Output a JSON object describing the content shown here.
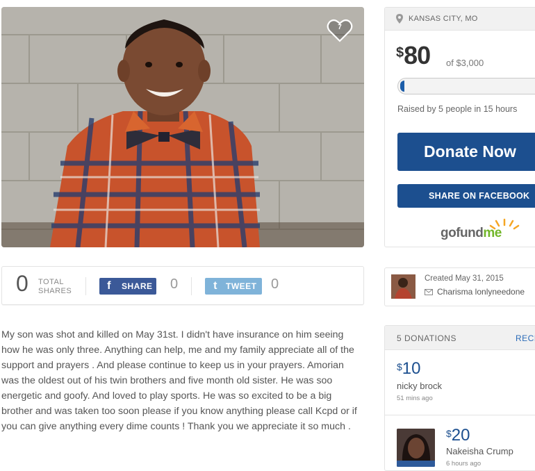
{
  "photo": {
    "heart_count": "7"
  },
  "shares": {
    "total": "0",
    "total_label_1": "TOTAL",
    "total_label_2": "SHARES",
    "facebook_label": "SHARE",
    "facebook_count": "0",
    "twitter_label": "TWEET",
    "twitter_count": "0"
  },
  "story": {
    "text": "My son was shot and killed on May 31st. I didn't have insurance on him seeing how he was only three. Anything can help, me and my family appreciate all of the support and prayers . And please continue to keep us in your prayers. Amorian was the oldest out of his twin brothers and five month old sister. He was soo energetic and goofy. And loved to play sports. He was so excited to be a big brother and was taken too soon please if you know anything please call Kcpd or if you can give anything every dime counts ! Thank you we appreciate it so much ."
  },
  "campaign": {
    "location": "KANSAS CITY, MO",
    "currency": "$",
    "raised": "80",
    "goal": "of $3,000",
    "progress_fraction": 0.027,
    "raised_by": "Raised by 5 people in 15 hours",
    "donate_label": "Donate Now",
    "share_facebook_label": "SHARE ON FACEBOOK",
    "logo_text_1": "gofund",
    "logo_text_2": "me",
    "accent_color": "#1c4f8f",
    "logo_color": "#72b629"
  },
  "organizer": {
    "created": "Created May 31, 2015",
    "name": "Charisma lonlyneedone"
  },
  "donations": {
    "header_count": "5 DONATIONS",
    "header_recent": "RECE",
    "items": [
      {
        "currency": "$",
        "amount": "10",
        "name": "nicky brock",
        "time": "51 mins ago"
      },
      {
        "currency": "$",
        "amount": "20",
        "name": "Nakeisha Crump",
        "time": "6 hours ago"
      }
    ]
  },
  "icons": {
    "heart": "heart-icon",
    "location": "map-pin-icon",
    "mail": "mail-icon",
    "facebook": "facebook-icon",
    "twitter": "twitter-icon"
  }
}
